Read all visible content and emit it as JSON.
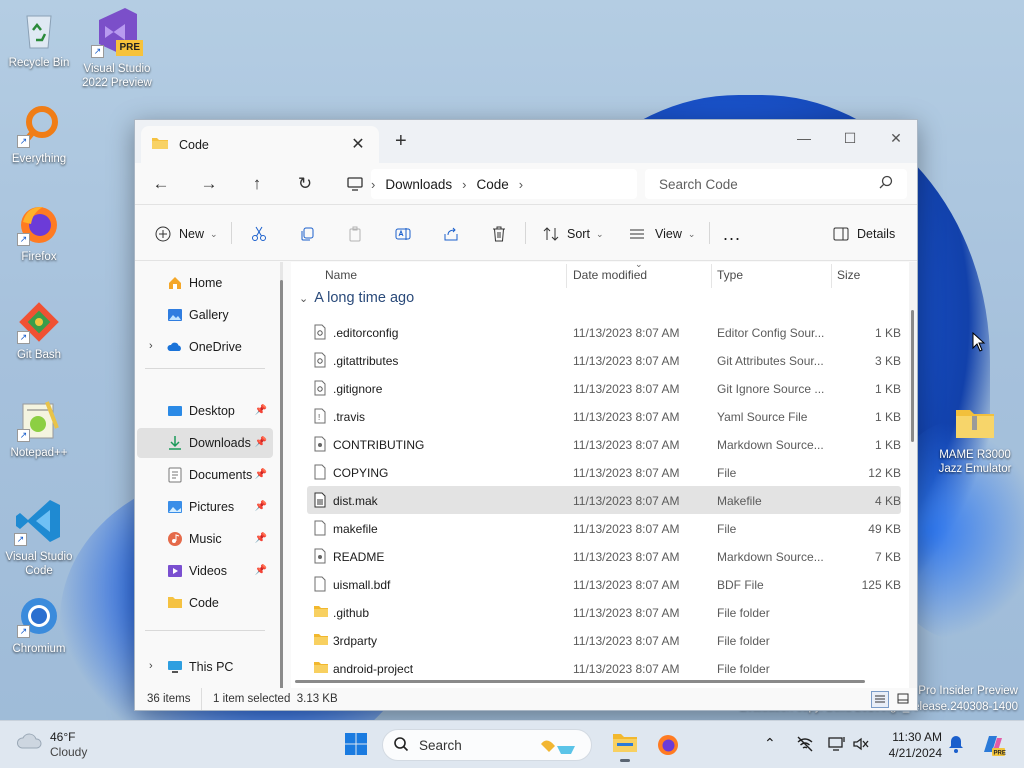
{
  "desktop": {
    "icons": [
      {
        "label": "Recycle Bin",
        "icon": "recycle-bin-icon"
      },
      {
        "label": "Visual Studio 2022 Preview",
        "icon": "visual-studio-preview-icon",
        "badge": "PRE"
      },
      {
        "label": "Everything",
        "icon": "everything-search-icon"
      },
      {
        "label": "Firefox",
        "icon": "firefox-icon"
      },
      {
        "label": "Git Bash",
        "icon": "git-bash-icon"
      },
      {
        "label": "Notepad++",
        "icon": "notepad-plus-plus-icon"
      },
      {
        "label": "Visual Studio Code",
        "icon": "vscode-icon"
      },
      {
        "label": "Chromium",
        "icon": "chromium-icon"
      },
      {
        "label": "MAME R3000 Jazz Emulator",
        "icon": "zip-folder-icon"
      }
    ],
    "watermark_line1": "Pro Insider Preview",
    "watermark_line2": "Evaluation copy. Build 26100.ge_release.240308-1400"
  },
  "window": {
    "tab_title": "Code",
    "new_tab": "+",
    "search_placeholder": "Search Code",
    "breadcrumb": [
      "Downloads",
      "Code"
    ],
    "toolbar": {
      "new_label": "New",
      "sort_label": "Sort",
      "view_label": "View",
      "more_label": "...",
      "details_label": "Details"
    },
    "nav": {
      "home": "Home",
      "gallery": "Gallery",
      "onedrive": "OneDrive",
      "desktop": "Desktop",
      "downloads": "Downloads",
      "documents": "Documents",
      "pictures": "Pictures",
      "music": "Music",
      "videos": "Videos",
      "code": "Code",
      "thispc": "This PC"
    },
    "columns": {
      "name": "Name",
      "date": "Date modified",
      "type": "Type",
      "size": "Size"
    },
    "group_label": "A long time ago",
    "files": [
      {
        "name": ".editorconfig",
        "date": "11/13/2023 8:07 AM",
        "type": "Editor Config Sour...",
        "size": "1 KB",
        "icon": "config-file-icon"
      },
      {
        "name": ".gitattributes",
        "date": "11/13/2023 8:07 AM",
        "type": "Git Attributes Sour...",
        "size": "3 KB",
        "icon": "config-file-icon"
      },
      {
        "name": ".gitignore",
        "date": "11/13/2023 8:07 AM",
        "type": "Git Ignore Source ...",
        "size": "1 KB",
        "icon": "config-file-icon"
      },
      {
        "name": ".travis",
        "date": "11/13/2023 8:07 AM",
        "type": "Yaml Source File",
        "size": "1 KB",
        "icon": "yaml-file-icon"
      },
      {
        "name": "CONTRIBUTING",
        "date": "11/13/2023 8:07 AM",
        "type": "Markdown Source...",
        "size": "1 KB",
        "icon": "markdown-file-icon"
      },
      {
        "name": "COPYING",
        "date": "11/13/2023 8:07 AM",
        "type": "File",
        "size": "12 KB",
        "icon": "blank-file-icon"
      },
      {
        "name": "dist.mak",
        "date": "11/13/2023 8:07 AM",
        "type": "Makefile",
        "size": "4 KB",
        "icon": "makefile-icon"
      },
      {
        "name": "makefile",
        "date": "11/13/2023 8:07 AM",
        "type": "File",
        "size": "49 KB",
        "icon": "blank-file-icon"
      },
      {
        "name": "README",
        "date": "11/13/2023 8:07 AM",
        "type": "Markdown Source...",
        "size": "7 KB",
        "icon": "markdown-file-icon"
      },
      {
        "name": "uismall.bdf",
        "date": "11/13/2023 8:07 AM",
        "type": "BDF File",
        "size": "125 KB",
        "icon": "blank-file-icon"
      },
      {
        "name": ".github",
        "date": "11/13/2023 8:07 AM",
        "type": "File folder",
        "size": "",
        "icon": "folder-icon"
      },
      {
        "name": "3rdparty",
        "date": "11/13/2023 8:07 AM",
        "type": "File folder",
        "size": "",
        "icon": "folder-icon"
      },
      {
        "name": "android-project",
        "date": "11/13/2023 8:07 AM",
        "type": "File folder",
        "size": "",
        "icon": "folder-icon"
      }
    ],
    "selected_index": 6,
    "status": {
      "count": "36 items",
      "selection": "1 item selected  3.13 KB"
    }
  },
  "taskbar": {
    "weather_temp": "46°F",
    "weather_desc": "Cloudy",
    "search_label": "Search",
    "time": "11:30 AM",
    "date": "4/21/2024"
  },
  "colors": {
    "accent": "#0067c0",
    "folder": "#f5c242",
    "selection": "#e3e3e3"
  }
}
